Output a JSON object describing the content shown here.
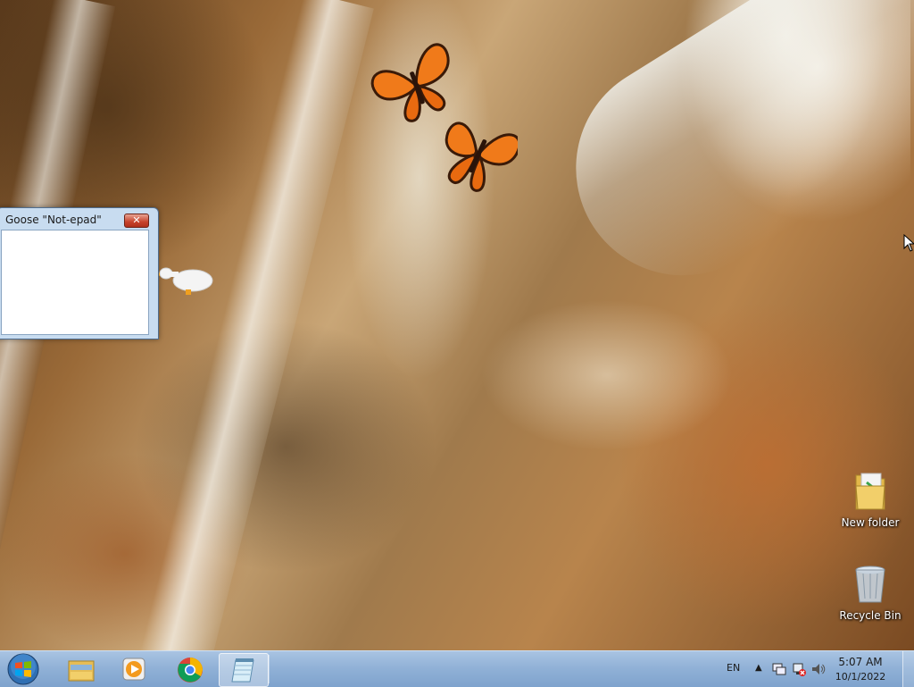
{
  "desktop": {
    "icons": [
      {
        "label": "New folder",
        "icon": "folder-icon"
      },
      {
        "label": "Recycle Bin",
        "icon": "recycle-bin-icon"
      }
    ]
  },
  "window": {
    "title": "Goose \"Not-epad\"",
    "close_glyph": "✕",
    "content": ""
  },
  "taskbar": {
    "pinned": [
      {
        "name": "Windows Explorer",
        "icon": "folder-icon"
      },
      {
        "name": "Windows Media Player",
        "icon": "media-player-icon"
      },
      {
        "name": "Google Chrome",
        "icon": "chrome-icon"
      },
      {
        "name": "Notepad",
        "icon": "notepad-icon",
        "active": true
      }
    ],
    "tray": {
      "language": "EN",
      "time": "5:07 AM",
      "date": "10/1/2022"
    }
  },
  "colors": {
    "taskbar": "#8fb0d6",
    "close_button": "#c7412b",
    "butterfly": "#f07a1a"
  }
}
